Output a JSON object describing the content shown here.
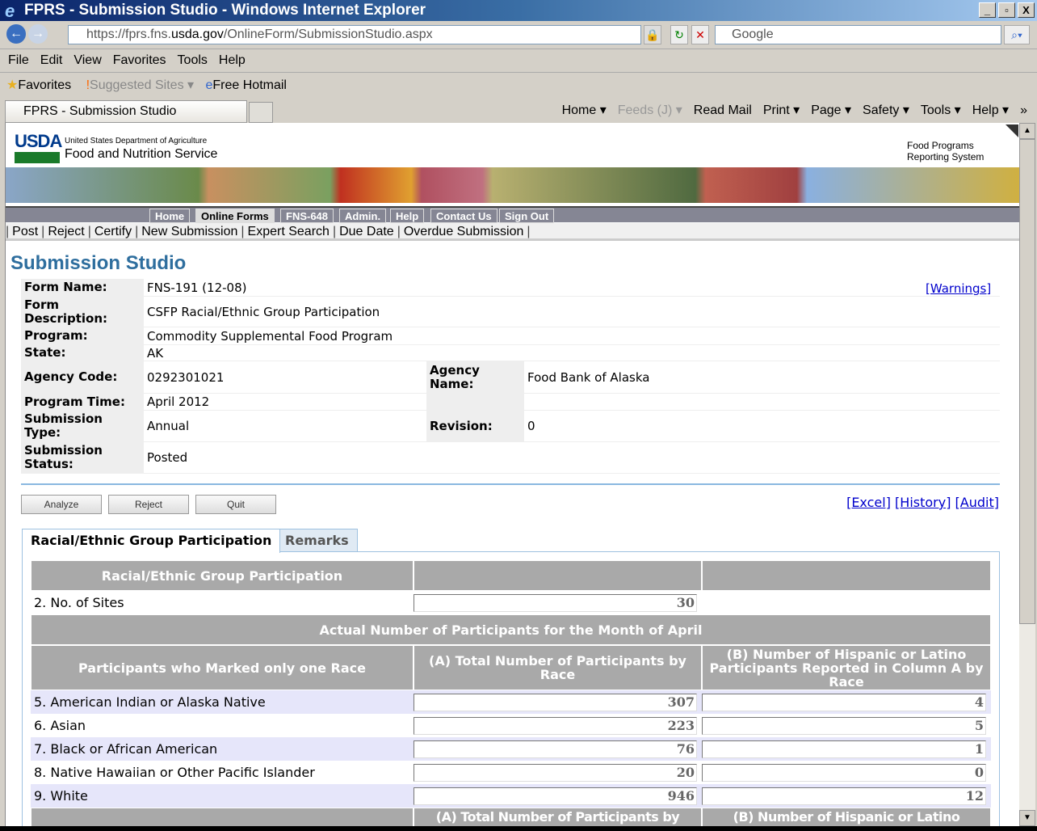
{
  "browser": {
    "title": "FPRS - Submission Studio - Windows Internet Explorer",
    "url_prefix": "https://fprs.fns.",
    "url_domain": "usda.gov",
    "url_path": "/OnlineForm/SubmissionStudio.aspx",
    "search_placeholder": "Google",
    "menu": [
      "File",
      "Edit",
      "View",
      "Favorites",
      "Tools",
      "Help"
    ],
    "favorites": [
      "Favorites",
      "Suggested Sites ▾",
      "Free Hotmail"
    ],
    "tab": "FPRS - Submission Studio",
    "commands": [
      "Home ▾",
      "Feeds (J) ▾",
      "Read Mail",
      "Print ▾",
      "Page ▾",
      "Safety ▾",
      "Tools ▾",
      "Help ▾",
      "»"
    ]
  },
  "header": {
    "logo": "USDA",
    "dept": "United States Department of Agriculture",
    "agency": "Food and Nutrition Service",
    "system_line1": "Food Programs",
    "system_line2": "Reporting System"
  },
  "nav": [
    "Home",
    "Online Forms",
    "FNS-648",
    "Admin.",
    "Help",
    "Contact Us",
    "Sign Out"
  ],
  "subnav": [
    "Post",
    "Reject",
    "Certify",
    "New Submission",
    "Expert Search",
    "Due Date",
    "Overdue Submission"
  ],
  "page_title": "Submission Studio",
  "warnings_link": "[Warnings]",
  "info": {
    "form_name_label": "Form Name:",
    "form_name": "FNS-191 (12-08)",
    "form_desc_label": "Form Description:",
    "form_desc": "CSFP Racial/Ethnic Group Participation",
    "program_label": "Program:",
    "program": "Commodity Supplemental Food Program",
    "state_label": "State:",
    "state": "AK",
    "agency_code_label": "Agency Code:",
    "agency_code": "0292301021",
    "agency_name_label": "Agency Name:",
    "agency_name": "Food Bank of Alaska",
    "program_time_label": "Program Time:",
    "program_time": "April 2012",
    "sub_type_label": "Submission Type:",
    "sub_type": "Annual",
    "revision_label": "Revision:",
    "revision": "0",
    "sub_status_label": "Submission Status:",
    "sub_status": "Posted"
  },
  "buttons": [
    "Analyze",
    "Reject",
    "Quit"
  ],
  "links": [
    "[Excel]",
    "[History]",
    "[Audit]"
  ],
  "tabs": [
    "Racial/Ethnic Group Participation",
    "Remarks"
  ],
  "grid": {
    "header": "Racial/Ethnic Group Participation",
    "sites_label": "2. No. of Sites",
    "sites": "30",
    "month_header": "Actual Number of Participants for the Month of April",
    "col0": "Participants who Marked only one Race",
    "colA": "(A) Total Number of Participants by Race",
    "colB": "(B) Number of Hispanic or Latino Participants Reported in Column A by Race",
    "rows": [
      {
        "label": "5. American Indian or Alaska Native",
        "a": "307",
        "b": "4"
      },
      {
        "label": "6. Asian",
        "a": "223",
        "b": "5"
      },
      {
        "label": "7. Black or African American",
        "a": "76",
        "b": "1"
      },
      {
        "label": "8. Native Hawaiian or Other Pacific Islander",
        "a": "20",
        "b": "0"
      },
      {
        "label": "9. White",
        "a": "946",
        "b": "12"
      }
    ],
    "next_colA": "(A) Total Number of Participants by",
    "next_colB": "(B) Number of Hispanic or Latino"
  }
}
